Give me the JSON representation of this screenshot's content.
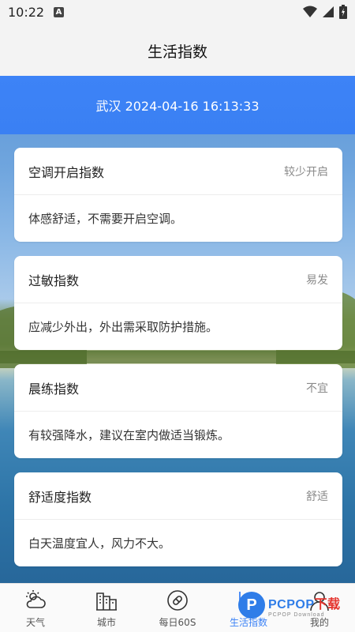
{
  "status_bar": {
    "time": "10:22",
    "notification_glyph": "A"
  },
  "title_bar": {
    "title": "生活指数"
  },
  "header": {
    "location_time": "武汉 2024-04-16 16:13:33"
  },
  "cards": [
    {
      "title": "空调开启指数",
      "level": "较少开启",
      "desc": "体感舒适，不需要开启空调。"
    },
    {
      "title": "过敏指数",
      "level": "易发",
      "desc": "应减少外出，外出需采取防护措施。"
    },
    {
      "title": "晨练指数",
      "level": "不宜",
      "desc": "有较强降水，建议在室内做适当锻炼。"
    },
    {
      "title": "舒适度指数",
      "level": "舒适",
      "desc": "白天温度宜人，风力不大。"
    }
  ],
  "nav": [
    {
      "label": "天气",
      "icon": "weather-icon"
    },
    {
      "label": "城市",
      "icon": "city-icon"
    },
    {
      "label": "每日60S",
      "icon": "daily-news-icon"
    },
    {
      "label": "生活指数",
      "icon": "life-index-icon",
      "active": true
    },
    {
      "label": "我的",
      "icon": "profile-icon"
    }
  ],
  "watermark": {
    "brand": "PCPOP",
    "brand_suffix": "下载",
    "sub": "PCPOP Download"
  },
  "colors": {
    "accent": "#3b82f6",
    "header_band": "#3d83f7",
    "watermark_blue": "#2f7de8",
    "watermark_red": "#e4322b"
  }
}
